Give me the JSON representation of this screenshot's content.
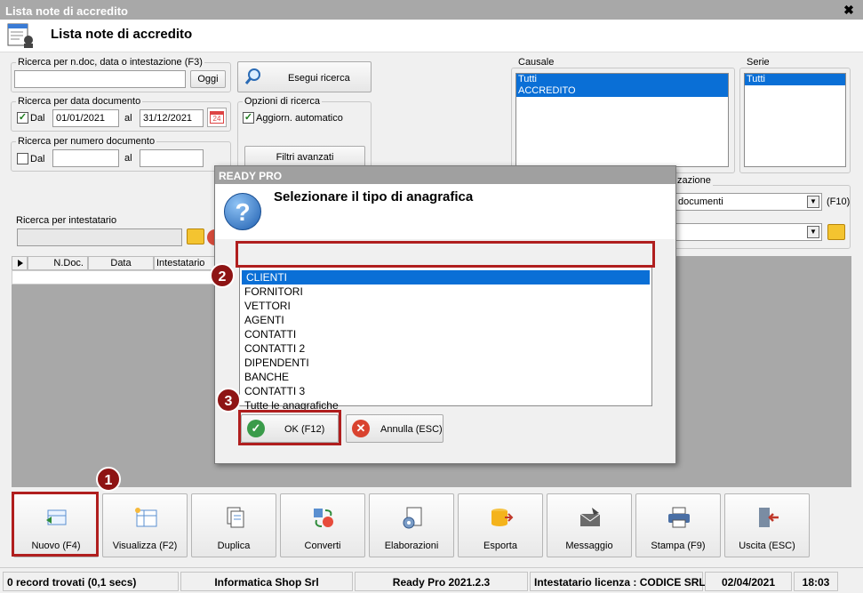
{
  "window": {
    "title": "Lista note di accredito",
    "close_glyph": "✖"
  },
  "header": {
    "title": "Lista note di accredito"
  },
  "search_text": {
    "label": "Ricerca per n.doc, data o intestazione (F3)",
    "value": "",
    "oggi_label": "Oggi"
  },
  "search_button": {
    "label": "Esegui ricerca"
  },
  "search_date": {
    "label": "Ricerca per data documento",
    "dal_checked": true,
    "dal_label": "Dal",
    "from": "01/01/2021",
    "al_label": "al",
    "to": "31/12/2021",
    "calendar_badge": "24"
  },
  "search_options": {
    "label": "Opzioni di ricerca",
    "auto_update_label": "Aggiorn. automatico",
    "auto_update_checked": true,
    "advanced_label": "Filtri avanzati"
  },
  "search_number": {
    "label": "Ricerca per numero documento",
    "dal_label": "Dal",
    "from": "",
    "al_label": "al",
    "to": ""
  },
  "search_holder": {
    "label": "Ricerca per intestatario",
    "value": ""
  },
  "causale": {
    "label": "Causale",
    "items": [
      "Tutti",
      "ACCREDITO"
    ]
  },
  "serie": {
    "label": "Serie",
    "items": [
      "Tutti"
    ]
  },
  "visualizzazione": {
    "label_fragment": "zazione",
    "combo_value": "documenti",
    "shortcut": "(F10)",
    "second_combo_value": ""
  },
  "grid": {
    "columns": [
      "N.Doc.",
      "Data",
      "Intestatario"
    ]
  },
  "toolbar": [
    {
      "label": "Nuovo (F4)",
      "icon": "new-document-icon"
    },
    {
      "label": "Visualizza (F2)",
      "icon": "view-table-icon"
    },
    {
      "label": "Duplica",
      "icon": "duplicate-icon"
    },
    {
      "label": "Converti",
      "icon": "convert-icon"
    },
    {
      "label": "Elaborazioni",
      "icon": "process-gear-icon"
    },
    {
      "label": "Esporta",
      "icon": "export-database-icon"
    },
    {
      "label": "Messaggio",
      "icon": "message-icon"
    },
    {
      "label": "Stampa (F9)",
      "icon": "printer-icon"
    },
    {
      "label": "Uscita (ESC)",
      "icon": "exit-door-icon"
    }
  ],
  "status": {
    "records": "0 record trovati (0,1 secs)",
    "company": "Informatica Shop Srl",
    "version": "Ready Pro 2021.2.3",
    "license": "Intestatario licenza : CODICE SRL",
    "date": "02/04/2021",
    "time": "18:03"
  },
  "dialog": {
    "title": "READY PRO",
    "heading": "Selezionare il tipo di anagrafica",
    "items": [
      "CLIENTI",
      "FORNITORI",
      "VETTORI",
      "AGENTI",
      "CONTATTI",
      "CONTATTI 2",
      "DIPENDENTI",
      "BANCHE",
      "CONTATTI 3",
      "Tutte le anagrafiche"
    ],
    "selected_index": 0,
    "ok_label": "OK (F12)",
    "cancel_label": "Annulla (ESC)"
  },
  "annotations": {
    "step1": "1",
    "step2": "2",
    "step3": "3"
  },
  "colors": {
    "selection": "#0a6fd6",
    "callout": "#b01e1e",
    "badge": "#8e1414"
  }
}
